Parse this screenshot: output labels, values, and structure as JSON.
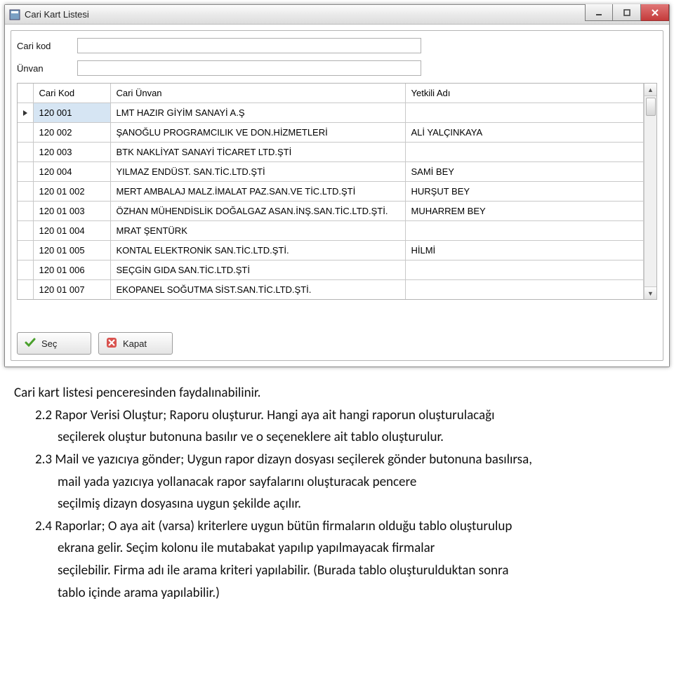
{
  "window": {
    "title": "Cari Kart Listesi"
  },
  "filters": {
    "kod_label": "Cari kod",
    "unvan_label": "Ünvan",
    "kod_value": "",
    "unvan_value": ""
  },
  "grid": {
    "headers": {
      "kod": "Cari Kod",
      "unvan": "Cari Ünvan",
      "yetkili": "Yetkili Adı"
    },
    "rows": [
      {
        "kod": "120 001",
        "unvan": "LMT HAZIR GİYİM SANAYİ A.Ş",
        "yetkili": ""
      },
      {
        "kod": "120 002",
        "unvan": "ŞANOĞLU PROGRAMCILIK VE DON.HİZMETLERİ",
        "yetkili": "ALİ YALÇINKAYA"
      },
      {
        "kod": "120 003",
        "unvan": "BTK NAKLİYAT SANAYİ TİCARET LTD.ŞTİ",
        "yetkili": ""
      },
      {
        "kod": "120 004",
        "unvan": "YILMAZ ENDÜST. SAN.TİC.LTD.ŞTİ",
        "yetkili": "SAMİ BEY"
      },
      {
        "kod": "120 01 002",
        "unvan": "MERT AMBALAJ MALZ.İMALAT PAZ.SAN.VE TİC.LTD.ŞTİ",
        "yetkili": "HURŞUT BEY"
      },
      {
        "kod": "120 01 003",
        "unvan": "ÖZHAN MÜHENDİSLİK DOĞALGAZ ASAN.İNŞ.SAN.TİC.LTD.ŞTİ.",
        "yetkili": "MUHARREM BEY"
      },
      {
        "kod": "120 01 004",
        "unvan": "MRAT ŞENTÜRK",
        "yetkili": ""
      },
      {
        "kod": "120 01 005",
        "unvan": "KONTAL ELEKTRONİK SAN.TİC.LTD.ŞTİ.",
        "yetkili": "HİLMİ"
      },
      {
        "kod": "120 01 006",
        "unvan": "SEÇGİN GIDA SAN.TİC.LTD.ŞTİ",
        "yetkili": ""
      },
      {
        "kod": "120 01 007",
        "unvan": "EKOPANEL SOĞUTMA SİST.SAN.TİC.LTD.ŞTİ.",
        "yetkili": ""
      }
    ]
  },
  "buttons": {
    "select": "Seç",
    "close": "Kapat"
  },
  "doc": {
    "p1": "Cari kart listesi penceresinden faydalınabilinir.",
    "p2_num": "2.2 Rapor Verisi Oluştur; Raporu oluşturur. Hangi aya ait hangi raporun oluşturulacağı",
    "p2_body": "seçilerek oluştur butonuna basılır ve o seçeneklere ait tablo oluşturulur.",
    "p3_num": "2.3 Mail ve yazıcıya gönder; Uygun rapor dizayn dosyası seçilerek gönder butonuna basılırsa,",
    "p3_body1": "mail yada yazıcıya yollanacak rapor sayfalarını oluşturacak pencere",
    "p3_body2": " seçilmiş dizayn dosyasına uygun şekilde açılır.",
    "p4_num": "2.4 Raporlar; O aya ait (varsa)  kriterlere uygun bütün firmaların olduğu tablo oluşturulup",
    "p4_body1": "ekrana gelir. Seçim kolonu ile mutabakat yapılıp yapılmayacak firmalar",
    "p4_body2": "seçilebilir. Firma adı ile arama kriteri yapılabilir. (Burada tablo oluşturulduktan sonra",
    "p4_body3": "tablo içinde arama yapılabilir.)"
  }
}
